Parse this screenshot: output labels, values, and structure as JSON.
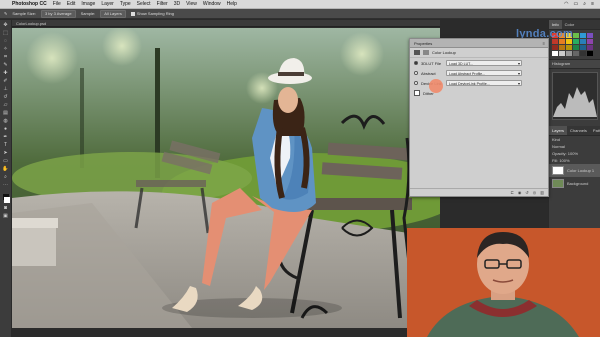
{
  "menubar": {
    "app": "Photoshop CC",
    "items": [
      "File",
      "Edit",
      "Image",
      "Layer",
      "Type",
      "Select",
      "Filter",
      "3D",
      "View",
      "Window",
      "Help"
    ]
  },
  "options": {
    "sample_size_label": "Sample Size:",
    "sample_size_value": "3 by 3 Average",
    "sample_label": "Sample:",
    "sample_value": "All Layers",
    "show_ring": "Show Sampling Ring"
  },
  "document": {
    "tab": "ColorLookup.psd"
  },
  "properties": {
    "title": "Properties",
    "subtitle": "Color Lookup",
    "rows": [
      {
        "label": "3DLUT File",
        "value": "Load 3D LUT..."
      },
      {
        "label": "Abstract",
        "value": "Load Abstract Profile..."
      },
      {
        "label": "Device Link",
        "value": "Load DeviceLink Profile..."
      }
    ],
    "dither": "Dither"
  },
  "right_panel": {
    "tabs": [
      "Info",
      "Color"
    ],
    "swatch_colors": [
      "#e23b2e",
      "#f08a24",
      "#f4d23a",
      "#6cc04a",
      "#2f9ad6",
      "#7a4fc0",
      "#c0392b",
      "#e67e22",
      "#f1c40f",
      "#27ae60",
      "#2980b9",
      "#8e44ad",
      "#922b21",
      "#b9770e",
      "#b7950b",
      "#1e8449",
      "#1f618d",
      "#6c3483",
      "#ffffff",
      "#cccccc",
      "#999999",
      "#666666",
      "#333333",
      "#000000"
    ],
    "adjustments_label": "Histogram",
    "layers_tabs": [
      "Layers",
      "Channels",
      "Paths"
    ],
    "kind": "Kind",
    "blend": "Normal",
    "opacity": "Opacity: 100%",
    "fill": "Fill: 100%",
    "layers": [
      {
        "name": "Color Lookup 1"
      },
      {
        "name": "Background"
      }
    ]
  },
  "watermark": "lynda.com"
}
